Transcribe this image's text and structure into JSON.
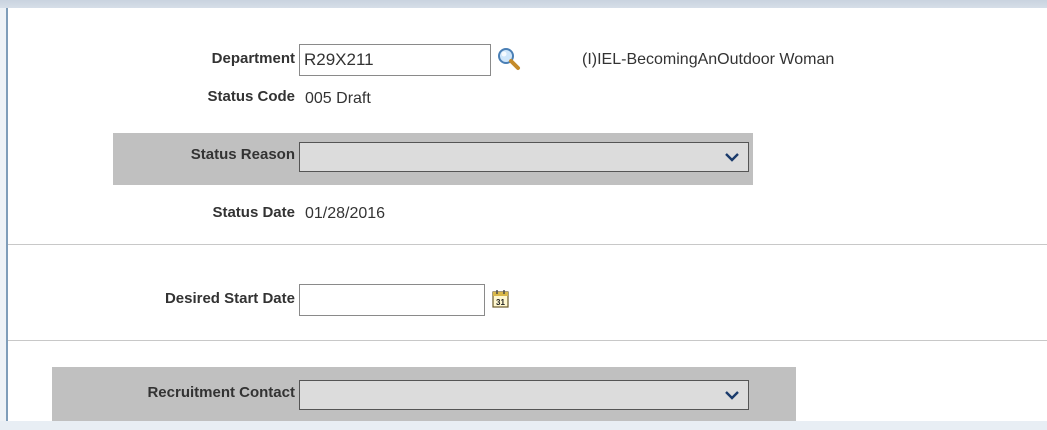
{
  "department": {
    "label": "Department",
    "value": "R29X211",
    "description": "(I)IEL-BecomingAnOutdoor Woman",
    "lookup_icon": "magnifier-icon"
  },
  "status_code": {
    "label": "Status Code",
    "value": "005 Draft"
  },
  "status_reason": {
    "label": "Status Reason",
    "selected": ""
  },
  "status_date": {
    "label": "Status Date",
    "value": "01/28/2016"
  },
  "desired_start_date": {
    "label": "Desired Start Date",
    "value": "",
    "calendar_icon": "calendar-icon",
    "calendar_text": "31"
  },
  "recruitment_contact": {
    "label": "Recruitment Contact",
    "selected": ""
  },
  "colors": {
    "border_blue": "#7f9db9",
    "shade": "#c0c0c0",
    "select_bg": "#dcdcdc"
  }
}
